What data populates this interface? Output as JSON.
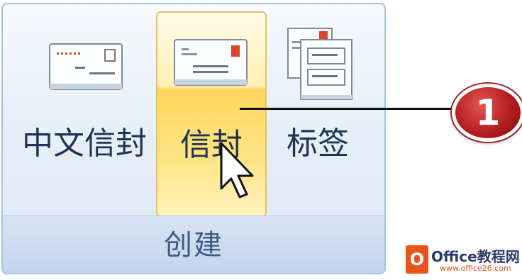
{
  "group": {
    "label": "创建",
    "buttons": [
      {
        "id": "chinese-envelope",
        "label": "中文信封",
        "icon": "chinese-envelope-icon"
      },
      {
        "id": "envelope",
        "label": "信封",
        "icon": "envelope-icon",
        "state": "hover"
      },
      {
        "id": "labels",
        "label": "标签",
        "icon": "labels-icon"
      }
    ]
  },
  "callout": {
    "number": "1"
  },
  "watermark": {
    "brand": "Office教程网",
    "url": "www.office26.com"
  },
  "colors": {
    "hover_fill": "#ffd65e",
    "badge_red": "#b51e1e",
    "group_border": "#a9c2dd"
  }
}
